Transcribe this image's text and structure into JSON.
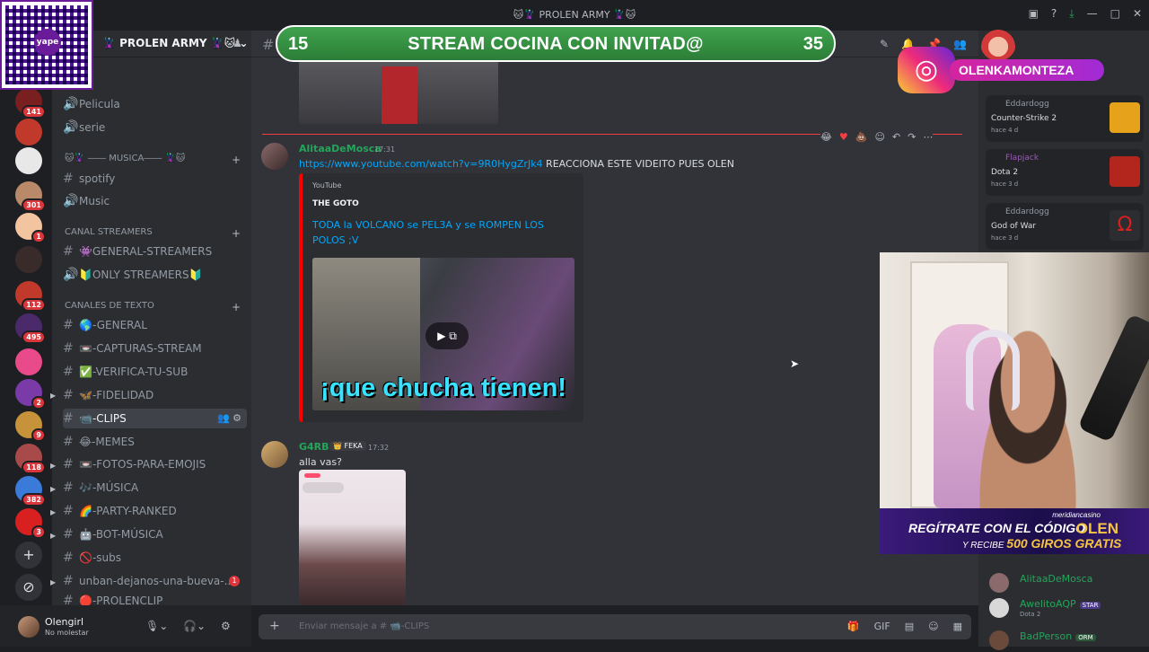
{
  "titlebar": {
    "title": "🐱🦹 PROLEN ARMY 🦹🐱"
  },
  "server": {
    "name": "🦹 PROLEN ARMY 🦹🐱"
  },
  "stream_banner": {
    "left_number": "15",
    "title": "STREAM COCINA CON INVITAD@",
    "right_number": "35"
  },
  "guilds": [
    {
      "badge": "141",
      "color": "#7a1f1f"
    },
    {
      "badge": "",
      "color": "#c0392b"
    },
    {
      "badge": "",
      "color": "#e8e8e8"
    },
    {
      "badge": "301",
      "color": "#b98a6a"
    },
    {
      "badge": "1",
      "color": "#f2c4a0"
    },
    {
      "badge": "",
      "color": "#3a2b2b"
    },
    {
      "badge": "112",
      "color": "#c0392b"
    },
    {
      "badge": "495",
      "color": "#4a2a6a"
    },
    {
      "badge": "",
      "color": "#e84a8a"
    },
    {
      "badge": "2",
      "color": "#7a3aa8"
    },
    {
      "badge": "9",
      "color": "#c7933a"
    },
    {
      "badge": "118",
      "color": "#a84a4a"
    },
    {
      "badge": "382",
      "color": "#3a7ad8"
    },
    {
      "badge": "3",
      "color": "#d82020"
    }
  ],
  "channels": [
    {
      "type": "voice",
      "name": "Pelicula"
    },
    {
      "type": "voice",
      "name": "serie"
    },
    {
      "type": "category",
      "name": "🐱🦹 ―― MUSICA―― 🦹🐱"
    },
    {
      "type": "text",
      "name": "spotify"
    },
    {
      "type": "voice",
      "name": "Music"
    },
    {
      "type": "category",
      "name": "CANAL STREAMERS"
    },
    {
      "type": "text",
      "name": "👾GENERAL-STREAMERS"
    },
    {
      "type": "voice",
      "name": "🔰ONLY STREAMERS🔰"
    },
    {
      "type": "category",
      "name": "CANALES DE TEXTO"
    },
    {
      "type": "text",
      "name": "🌎-GENERAL"
    },
    {
      "type": "text",
      "name": "📼-CAPTURAS-STREAM"
    },
    {
      "type": "text",
      "name": "✅-VERIFICA-TU-SUB"
    },
    {
      "type": "text",
      "name": "🦋-FIDELIDAD"
    },
    {
      "type": "text",
      "name": "📹-CLIPS"
    },
    {
      "type": "text",
      "name": "😂-MEMES"
    },
    {
      "type": "text",
      "name": "📼-FOTOS-PARA-EMOJIS"
    },
    {
      "type": "text",
      "name": "🎶-MÚSICA"
    },
    {
      "type": "text",
      "name": "🌈-PARTY-RANKED"
    },
    {
      "type": "text",
      "name": "🤖-BOT-MÚSICA"
    },
    {
      "type": "text",
      "name": "🚫-subs"
    },
    {
      "type": "text",
      "name": "unban-dejanos-una-bueva-...",
      "mention": "1"
    },
    {
      "type": "text",
      "name": "🔴-PROLENCLIP"
    }
  ],
  "user": {
    "name": "Olengirl",
    "status": "No molestar"
  },
  "messages": [
    {
      "author": "AlitaaDeMosca",
      "time": "17:31",
      "link": "https://www.youtube.com/watch?v=9R0HygZrJk4",
      "text": " REACCIONA ESTE VIDEITO PUES OLEN",
      "embed": {
        "provider": "YouTube",
        "channel": "THE GOTO",
        "title": "TODA la VOLCANO se PEL3A y se ROMPEN LOS POLOS ;V",
        "caption": "¡que chucha tienen!"
      }
    },
    {
      "author": "G4RB",
      "badge": "FEKA",
      "time": "17:32",
      "text": "alla vas?"
    }
  ],
  "composer": {
    "placeholder": "Enviar mensaje a # 📹-CLIPS"
  },
  "activities": [
    {
      "user": "Eddardogg",
      "game": "Counter-Strike 2",
      "when": "hace 4 d"
    },
    {
      "user": "Flapjack",
      "game": "Dota 2",
      "when": "hace 3 d"
    },
    {
      "user": "Eddardogg",
      "game": "God of War",
      "when": "hace 3 d"
    }
  ],
  "members": [
    {
      "name": "AlitaaDeMosca",
      "sub": ""
    },
    {
      "name": "AwelitoAQP",
      "tag": "STAR",
      "sub": "Dota 2"
    },
    {
      "name": "BadPerson",
      "tag": "ORM",
      "sub": ""
    }
  ],
  "overlay": {
    "instagram": "OLENKAMONTEZA",
    "promo_site": "meridiancasino",
    "promo_line1": "REGÍTRATE CON EL CÓDIGO",
    "promo_code": "OLEN",
    "promo_line2_a": "Y RECIBE ",
    "promo_line2_b": "500 GIROS GRATIS"
  },
  "colors": {
    "accent_red": "#f23f43",
    "link": "#00a8fc",
    "green_banner": "#3fa34d"
  }
}
